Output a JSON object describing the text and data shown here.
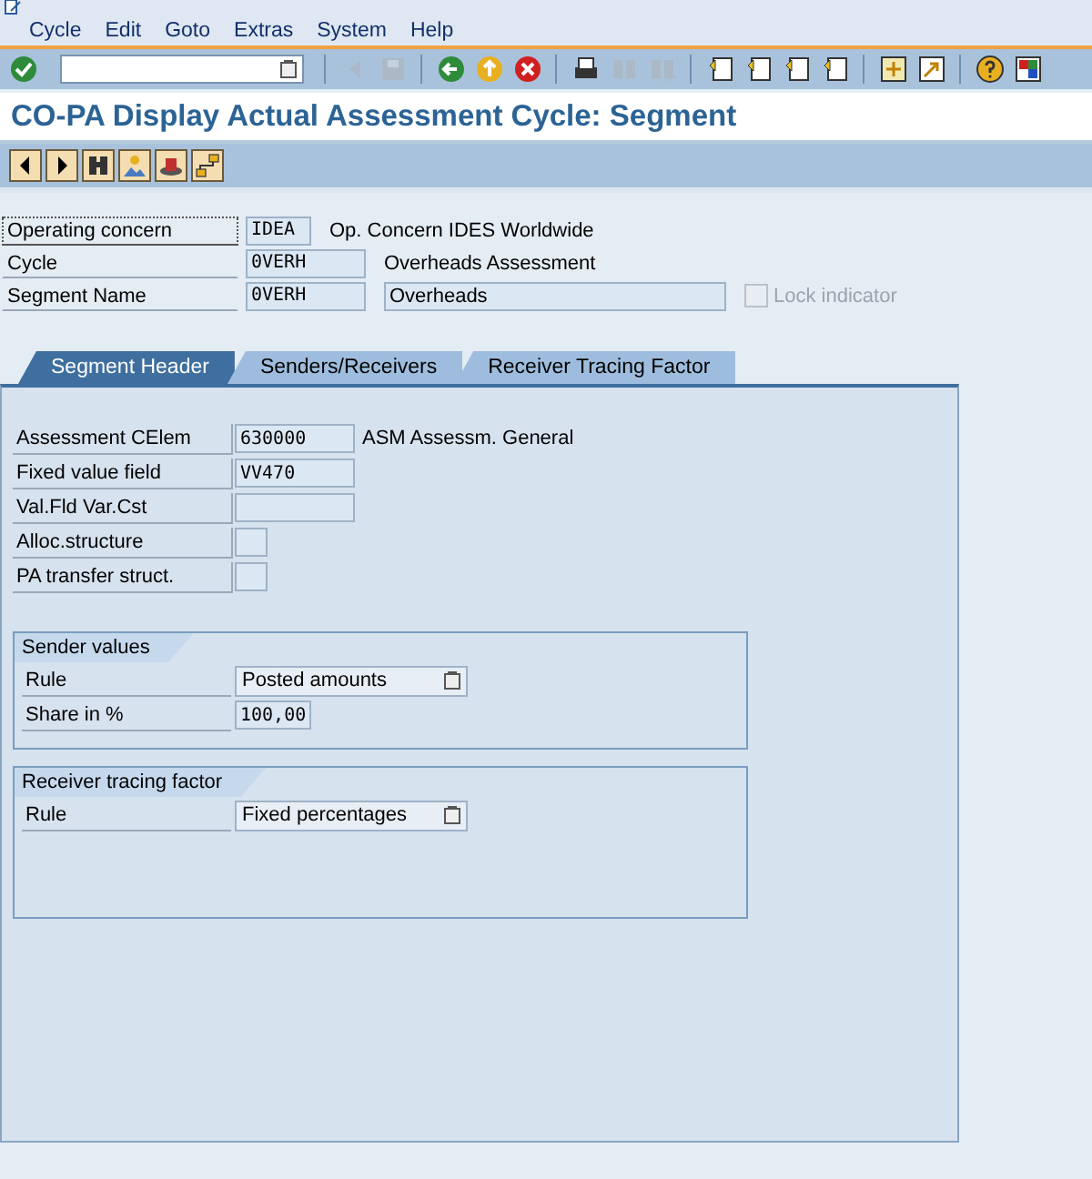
{
  "menu": [
    "Cycle",
    "Edit",
    "Goto",
    "Extras",
    "System",
    "Help"
  ],
  "system_toolbar": [
    {
      "kind": "enter",
      "disabled": false
    },
    {
      "kind": "command_field"
    },
    {
      "kind": "separator"
    },
    {
      "kind": "back_small",
      "disabled": true
    },
    {
      "kind": "save",
      "disabled": true
    },
    {
      "kind": "separator"
    },
    {
      "kind": "back",
      "disabled": false
    },
    {
      "kind": "exit",
      "disabled": false
    },
    {
      "kind": "cancel",
      "disabled": false
    },
    {
      "kind": "separator"
    },
    {
      "kind": "print",
      "disabled": false
    },
    {
      "kind": "find",
      "disabled": true
    },
    {
      "kind": "find_next",
      "disabled": true
    },
    {
      "kind": "separator"
    },
    {
      "kind": "first_page",
      "disabled": false
    },
    {
      "kind": "prev_page",
      "disabled": false
    },
    {
      "kind": "next_page",
      "disabled": false
    },
    {
      "kind": "last_page",
      "disabled": false
    },
    {
      "kind": "separator"
    },
    {
      "kind": "new_session",
      "disabled": false
    },
    {
      "kind": "shortcut",
      "disabled": false
    },
    {
      "kind": "separator"
    },
    {
      "kind": "help",
      "disabled": false
    },
    {
      "kind": "layout",
      "disabled": false
    }
  ],
  "title": "CO-PA Display Actual Assessment Cycle: Segment",
  "app_toolbar": [
    {
      "kind": "previous"
    },
    {
      "kind": "next"
    },
    {
      "kind": "find"
    },
    {
      "kind": "person"
    },
    {
      "kind": "hat"
    },
    {
      "kind": "hierarchy"
    }
  ],
  "header_fields": [
    {
      "label": "Operating concern",
      "focused": true,
      "value": {
        "kind": "short",
        "text": "IDEA"
      },
      "description": {
        "kind": "text",
        "text": "Op. Concern IDES Worldwide"
      }
    },
    {
      "label": "Cycle",
      "focused": false,
      "value": {
        "kind": "input",
        "text": "0VERH"
      },
      "description": {
        "kind": "text",
        "text": "Overheads Assessment"
      }
    },
    {
      "label": "Segment Name",
      "focused": false,
      "value": {
        "kind": "input",
        "text": "0VERH"
      },
      "description": {
        "kind": "field",
        "text": "Overheads"
      },
      "checkbox": {
        "label": "Lock indicator",
        "checked": false,
        "disabled": true
      }
    }
  ],
  "tabs": [
    {
      "label": "Segment Header",
      "selected": true
    },
    {
      "label": "Senders/Receivers",
      "selected": false
    },
    {
      "label": "Receiver Tracing Factor",
      "selected": false
    }
  ],
  "segment_fields": [
    {
      "label": "Assessment CElem",
      "kind": "input",
      "value": "630000",
      "description": "ASM Assessm. General"
    },
    {
      "label": "Fixed value field",
      "kind": "input",
      "value": "VV470"
    },
    {
      "label": "Val.Fld Var.Cst",
      "kind": "input"
    },
    {
      "label": "Alloc.structure",
      "kind": "small"
    },
    {
      "label": "PA transfer struct.",
      "kind": "small"
    }
  ],
  "groups": [
    {
      "title": "Sender values",
      "rows": [
        {
          "label": "Rule",
          "kind": "dropdown",
          "value": "Posted amounts"
        },
        {
          "label": "Share in %",
          "kind": "number",
          "value": "100,00"
        }
      ]
    },
    {
      "title": "Receiver tracing factor",
      "rows": [
        {
          "label": "Rule",
          "kind": "dropdown",
          "value": "Fixed percentages"
        }
      ]
    }
  ]
}
